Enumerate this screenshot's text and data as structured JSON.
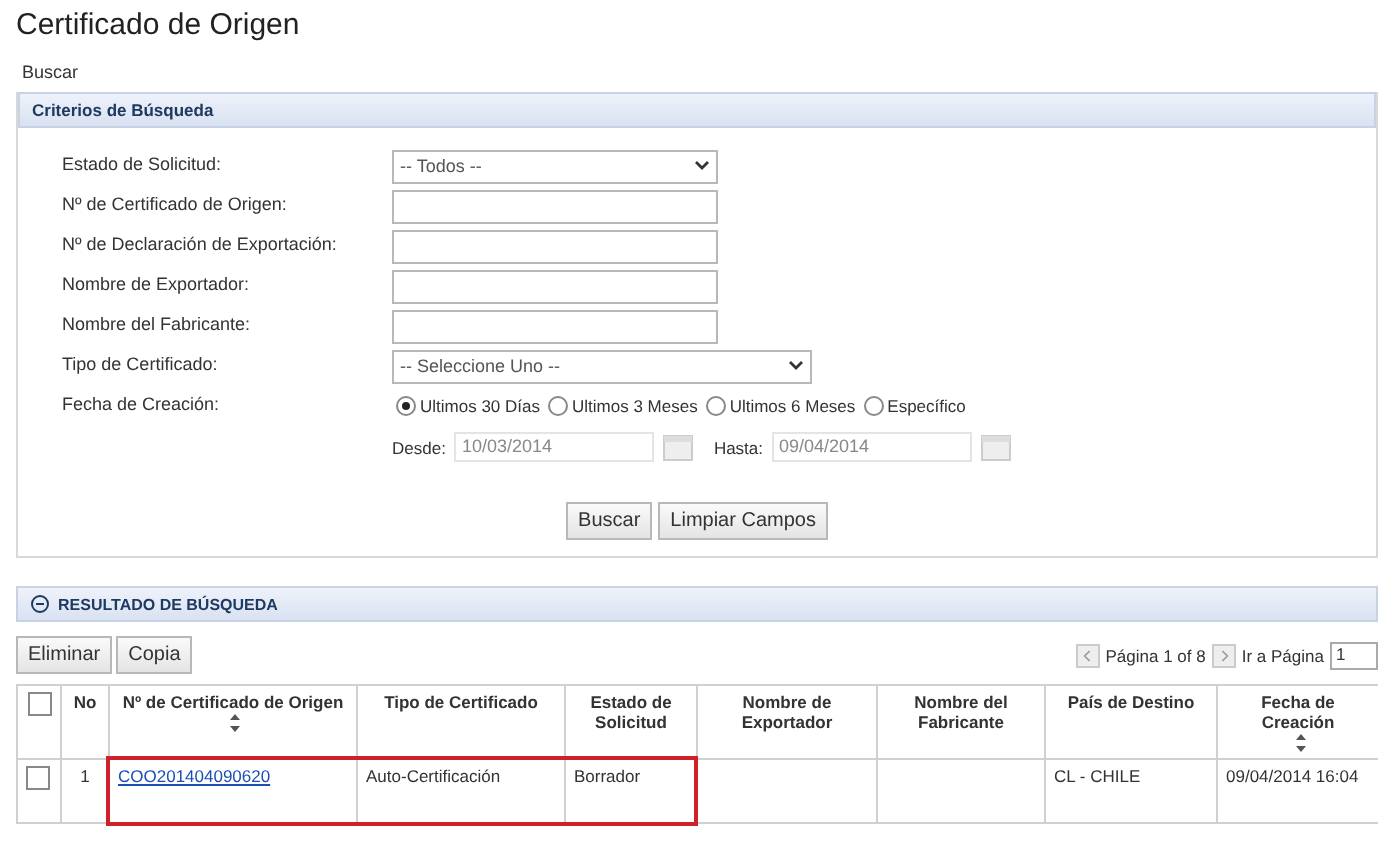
{
  "page": {
    "title": "Certificado de Origen",
    "breadcrumb": "Buscar"
  },
  "criteria": {
    "title": "Criterios de Búsqueda",
    "fields": [
      {
        "kind": "select",
        "label": "Estado de Solicitud:",
        "value": "-- Todos --"
      },
      {
        "kind": "text",
        "label": "Nº de Certificado de Origen:"
      },
      {
        "kind": "text",
        "label": "Nº de Declaración de Exportación:"
      },
      {
        "kind": "text",
        "label": "Nombre de Exportador:"
      },
      {
        "kind": "text",
        "label": "Nombre del Fabricante:"
      },
      {
        "kind": "wideselect",
        "label": "Tipo de Certificado:",
        "value": "-- Seleccione Uno --"
      },
      {
        "kind": "radios",
        "label": "Fecha de Creación:",
        "options": [
          {
            "label": "Ultimos 30 Días",
            "selected": true
          },
          {
            "label": "Ultimos 3 Meses",
            "selected": false
          },
          {
            "label": "Ultimos 6 Meses",
            "selected": false
          },
          {
            "label": "Específico",
            "selected": false
          }
        ]
      }
    ],
    "date_range": {
      "from_label": "Desde:",
      "from_value": "10/03/2014",
      "to_label": "Hasta:",
      "to_value": "09/04/2014"
    },
    "buttons": [
      "Buscar",
      "Limpiar Campos"
    ]
  },
  "results": {
    "title": "RESULTADO DE BÚSQUEDA",
    "actions": [
      "Eliminar",
      "Copia"
    ],
    "pager": {
      "page_text": "Página 1 of 8",
      "goto_label": "Ir a Página",
      "goto_value": "1"
    },
    "select_all": {
      "checked": false
    },
    "columns": [
      {
        "label": "No",
        "kind": "plain"
      },
      {
        "label": "Nº de Certificado de Origen",
        "kind": "sortable"
      },
      {
        "label": "Tipo de Certificado",
        "kind": "plain"
      },
      {
        "label": "Estado de Solicitud",
        "kind": "plain"
      },
      {
        "label": "Nombre de Exportador",
        "kind": "plain"
      },
      {
        "label": "Nombre del Fabricante",
        "kind": "plain"
      },
      {
        "label": "País de Destino",
        "kind": "plain"
      },
      {
        "label": "Fecha de Creación",
        "kind": "sortable"
      }
    ],
    "rows": [
      {
        "checked": false,
        "highlighted": true,
        "no": "1",
        "certificate": "COO201404090620",
        "type": "Auto-Certificación",
        "status": "Borrador",
        "country": "CL - CHILE",
        "created": "09/04/2014 16:04"
      }
    ]
  }
}
